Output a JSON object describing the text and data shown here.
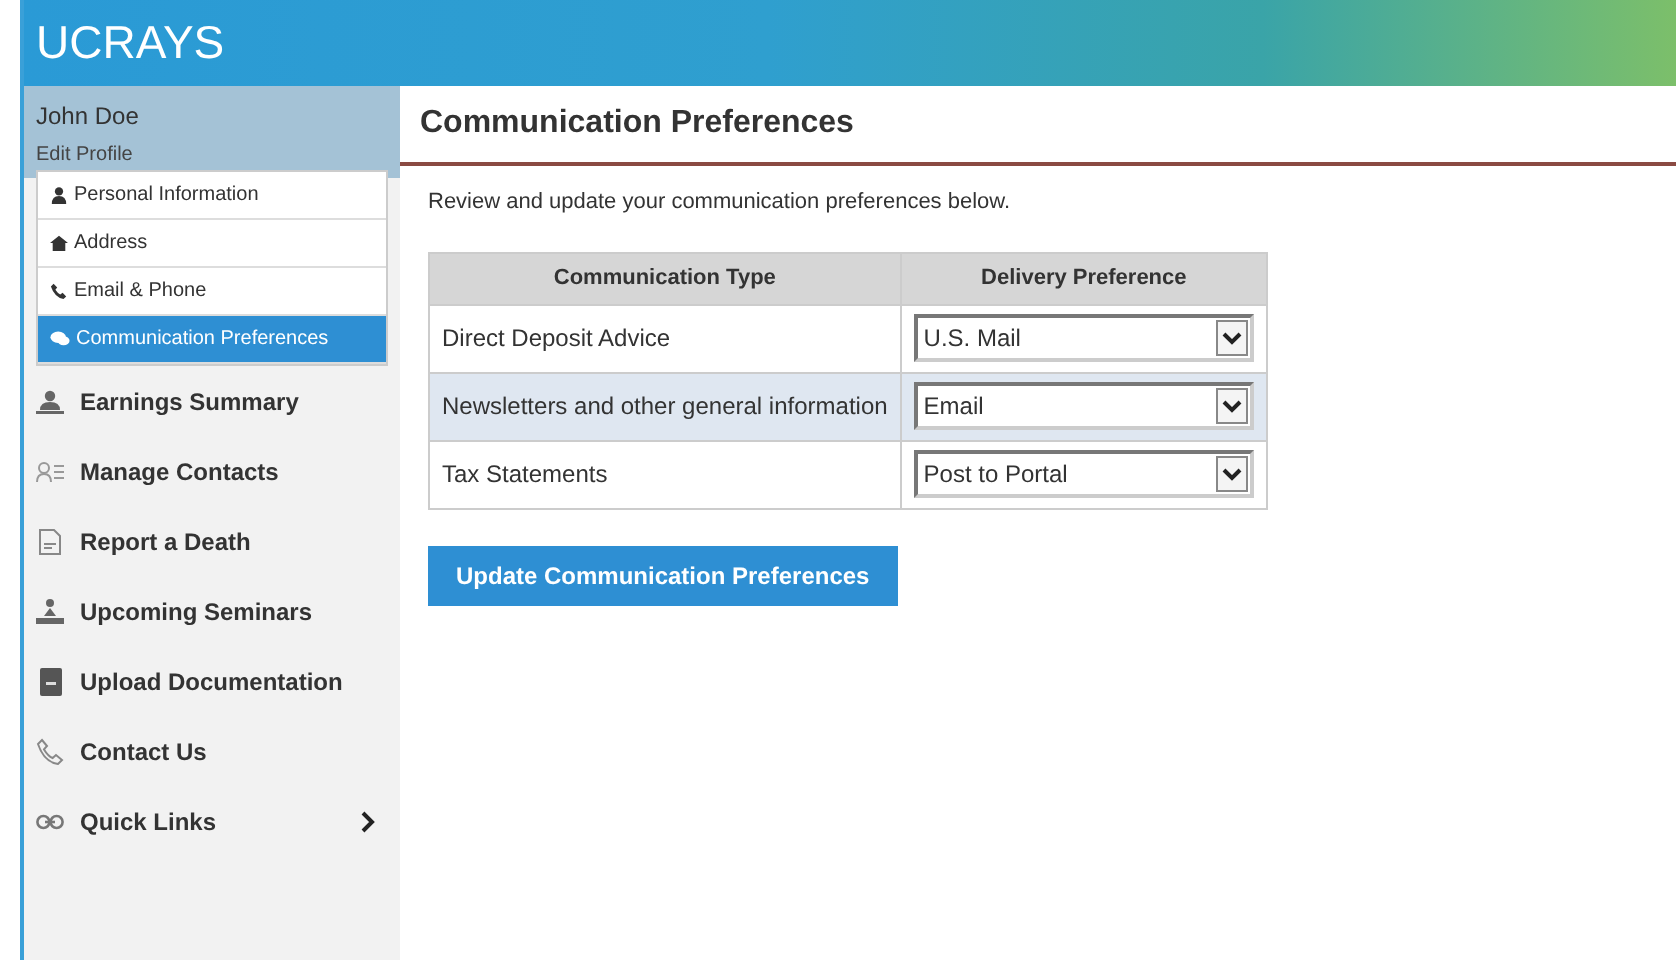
{
  "header": {
    "title": "UCRAYS"
  },
  "sidebar": {
    "user_name": "John Doe",
    "edit_profile": "Edit Profile",
    "profile_items": [
      {
        "label": "Personal Information",
        "selected": false
      },
      {
        "label": "Address",
        "selected": false
      },
      {
        "label": "Email & Phone",
        "selected": false
      },
      {
        "label": "Communication Preferences",
        "selected": true
      }
    ],
    "items": [
      {
        "label": "Earnings Summary",
        "has_submenu": false
      },
      {
        "label": "Manage Contacts",
        "has_submenu": false
      },
      {
        "label": "Report a Death",
        "has_submenu": false
      },
      {
        "label": "Upcoming Seminars",
        "has_submenu": false
      },
      {
        "label": "Upload Documentation",
        "has_submenu": false
      },
      {
        "label": "Contact Us",
        "has_submenu": false
      },
      {
        "label": "Quick Links",
        "has_submenu": true
      }
    ]
  },
  "main": {
    "title": "Communication Preferences",
    "intro": "Review and update your communication preferences below.",
    "table": {
      "columns": [
        "Communication Type",
        "Delivery Preference"
      ],
      "rows": [
        {
          "type": "Direct Deposit Advice",
          "delivery": "U.S. Mail",
          "highlighted": false
        },
        {
          "type": "Newsletters and other general information",
          "delivery": "Email",
          "highlighted": true
        },
        {
          "type": "Tax Statements",
          "delivery": "Post to Portal",
          "highlighted": false
        }
      ]
    },
    "button": "Update Communication Preferences"
  }
}
